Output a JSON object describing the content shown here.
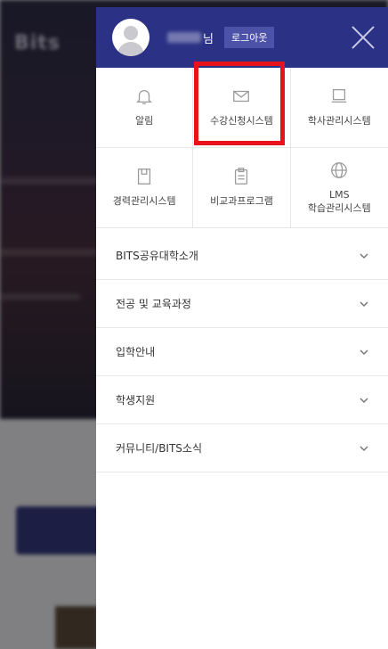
{
  "header": {
    "user_suffix": "님",
    "logout_label": "로그아웃"
  },
  "quick_links": [
    {
      "label": "알림",
      "icon": "bell-icon"
    },
    {
      "label": "수강신청시스템",
      "icon": "envelope-icon"
    },
    {
      "label": "학사관리시스템",
      "icon": "laptop-icon"
    },
    {
      "label": "경력관리시스템",
      "icon": "book-icon"
    },
    {
      "label": "비교과프로그램",
      "icon": "clipboard-icon"
    },
    {
      "label": "LMS\n학습관리시스템",
      "icon": "globe-icon"
    }
  ],
  "menu": [
    {
      "label": "BITS공유대학소개"
    },
    {
      "label": "전공 및 교육과정"
    },
    {
      "label": "입학안내"
    },
    {
      "label": "학생지원"
    },
    {
      "label": "커뮤니티/BITS소식"
    }
  ],
  "colors": {
    "header_bg": "#2b3185",
    "highlight": "#e8121d"
  }
}
